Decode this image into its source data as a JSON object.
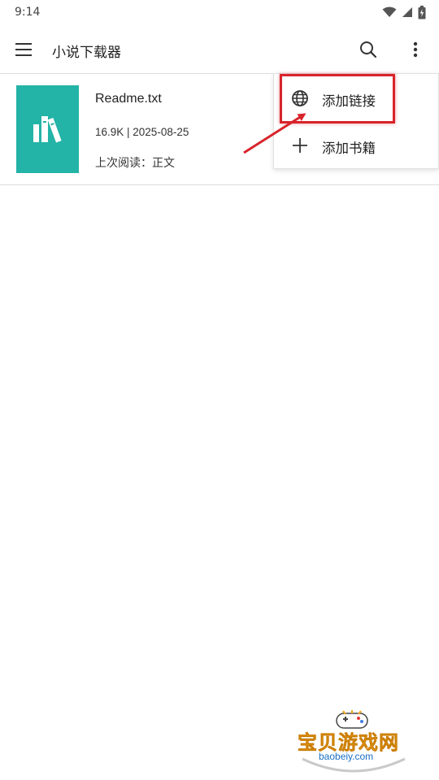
{
  "status_bar": {
    "time": "9:14"
  },
  "toolbar": {
    "title": "小说下载器",
    "menu_icon": "hamburger-menu-icon",
    "search_icon": "search-icon",
    "more_icon": "more-vert-icon"
  },
  "books": [
    {
      "name": "Readme.txt",
      "meta": "16.9K | 2025-08-25",
      "progress": "上次阅读：正文",
      "cover_color": "#23b3a7"
    }
  ],
  "popup_menu": {
    "items": [
      {
        "label": "添加链接",
        "icon": "globe-icon"
      },
      {
        "label": "添加书籍",
        "icon": "plus-icon"
      }
    ]
  },
  "annotation": {
    "highlight_color": "#d8242b"
  },
  "watermark": {
    "title": "宝贝游戏网",
    "url": "baobeiy.com"
  }
}
